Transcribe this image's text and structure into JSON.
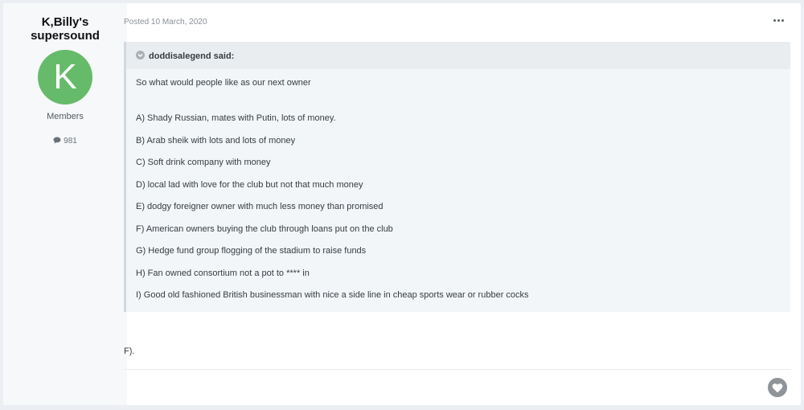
{
  "author": {
    "name_line1": "K,Billy's",
    "name_line2": "supersound",
    "avatar_letter": "K",
    "avatar_color": "#66bb6a",
    "group": "Members",
    "post_count": "981"
  },
  "post": {
    "posted_label": "Posted 10 March, 2020",
    "quote": {
      "citation": "doddisalegend said:",
      "lines": [
        "So what would people like as our next owner",
        "A) Shady Russian, mates with Putin, lots of money.",
        "B) Arab sheik with lots and lots of money",
        "C) Soft drink company with money",
        "D) local lad with love for the club but not that much money",
        "E) dodgy foreigner owner with much less money than promised",
        "F) American owners buying the club through loans put on the club",
        "G) Hedge fund group flogging of the stadium to raise funds",
        "H) Fan owned consortium not a pot to **** in",
        "I) Good old fashioned British businessman with nice a side line in cheap sports wear or rubber cocks"
      ]
    },
    "reply": "F)."
  }
}
